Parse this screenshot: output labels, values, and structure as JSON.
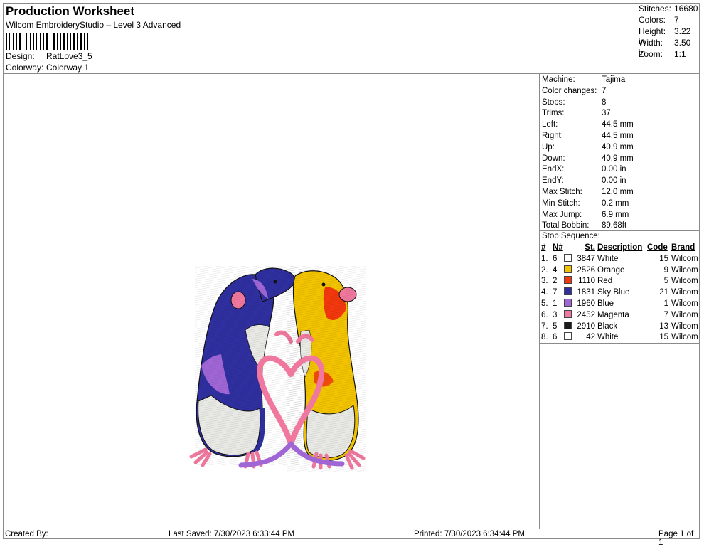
{
  "header": {
    "title": "Production Worksheet",
    "subtitle": "Wilcom EmbroideryStudio – Level 3 Advanced",
    "design_label": "Design:",
    "design_value": "RatLove3_5",
    "colorway_label": "Colorway:",
    "colorway_value": "Colorway 1"
  },
  "stats": [
    {
      "label": "Stitches:",
      "value": "16680"
    },
    {
      "label": "Colors:",
      "value": "7"
    },
    {
      "label": "Height:",
      "value": "3.22 in"
    },
    {
      "label": "Width:",
      "value": "3.50 in"
    },
    {
      "label": "Zoom:",
      "value": "1:1"
    }
  ],
  "machine_info": [
    {
      "label": "Machine:",
      "value": "Tajima"
    },
    {
      "label": "Color changes:",
      "value": "7"
    },
    {
      "label": "Stops:",
      "value": "8"
    },
    {
      "label": "Trims:",
      "value": "37"
    },
    {
      "label": "Left:",
      "value": "44.5 mm"
    },
    {
      "label": "Right:",
      "value": "44.5 mm"
    },
    {
      "label": "Up:",
      "value": "40.9 mm"
    },
    {
      "label": "Down:",
      "value": "40.9 mm"
    },
    {
      "label": "EndX:",
      "value": "0.00 in"
    },
    {
      "label": "EndY:",
      "value": "0.00 in"
    },
    {
      "label": "Max Stitch:",
      "value": "12.0 mm"
    },
    {
      "label": "Min Stitch:",
      "value": "0.2 mm"
    },
    {
      "label": "Max Jump:",
      "value": "6.9 mm"
    },
    {
      "label": "Total Bobbin:",
      "value": "89.68ft"
    }
  ],
  "stop_sequence": {
    "title": "Stop Sequence:",
    "headers": {
      "seq": "#",
      "n": "N#",
      "st": "St.",
      "desc": "Description",
      "code": "Code",
      "brand": "Brand"
    },
    "rows": [
      {
        "seq": "1.",
        "n": "6",
        "color": "#ffffff",
        "st": "3847",
        "desc": "White",
        "code": "15",
        "brand": "Wilcom"
      },
      {
        "seq": "2.",
        "n": "4",
        "color": "#f2c300",
        "st": "2526",
        "desc": "Orange",
        "code": "9",
        "brand": "Wilcom"
      },
      {
        "seq": "3.",
        "n": "2",
        "color": "#f2380c",
        "st": "1110",
        "desc": "Red",
        "code": "5",
        "brand": "Wilcom"
      },
      {
        "seq": "4.",
        "n": "7",
        "color": "#2f2fa0",
        "st": "1831",
        "desc": "Sky Blue",
        "code": "21",
        "brand": "Wilcom"
      },
      {
        "seq": "5.",
        "n": "1",
        "color": "#a066d6",
        "st": "1960",
        "desc": "Blue",
        "code": "1",
        "brand": "Wilcom"
      },
      {
        "seq": "6.",
        "n": "3",
        "color": "#f0789e",
        "st": "2452",
        "desc": "Magenta",
        "code": "7",
        "brand": "Wilcom"
      },
      {
        "seq": "7.",
        "n": "5",
        "color": "#1a1a1a",
        "st": "2910",
        "desc": "Black",
        "code": "13",
        "brand": "Wilcom"
      },
      {
        "seq": "8.",
        "n": "6",
        "color": "#ffffff",
        "st": "42",
        "desc": "White",
        "code": "15",
        "brand": "Wilcom"
      }
    ]
  },
  "footer": {
    "created_by": "Created By:",
    "last_saved": "Last Saved: 7/30/2023 6:33:44 PM",
    "printed": "Printed: 7/30/2023 6:34:44 PM",
    "page": "Page 1 of 1"
  }
}
